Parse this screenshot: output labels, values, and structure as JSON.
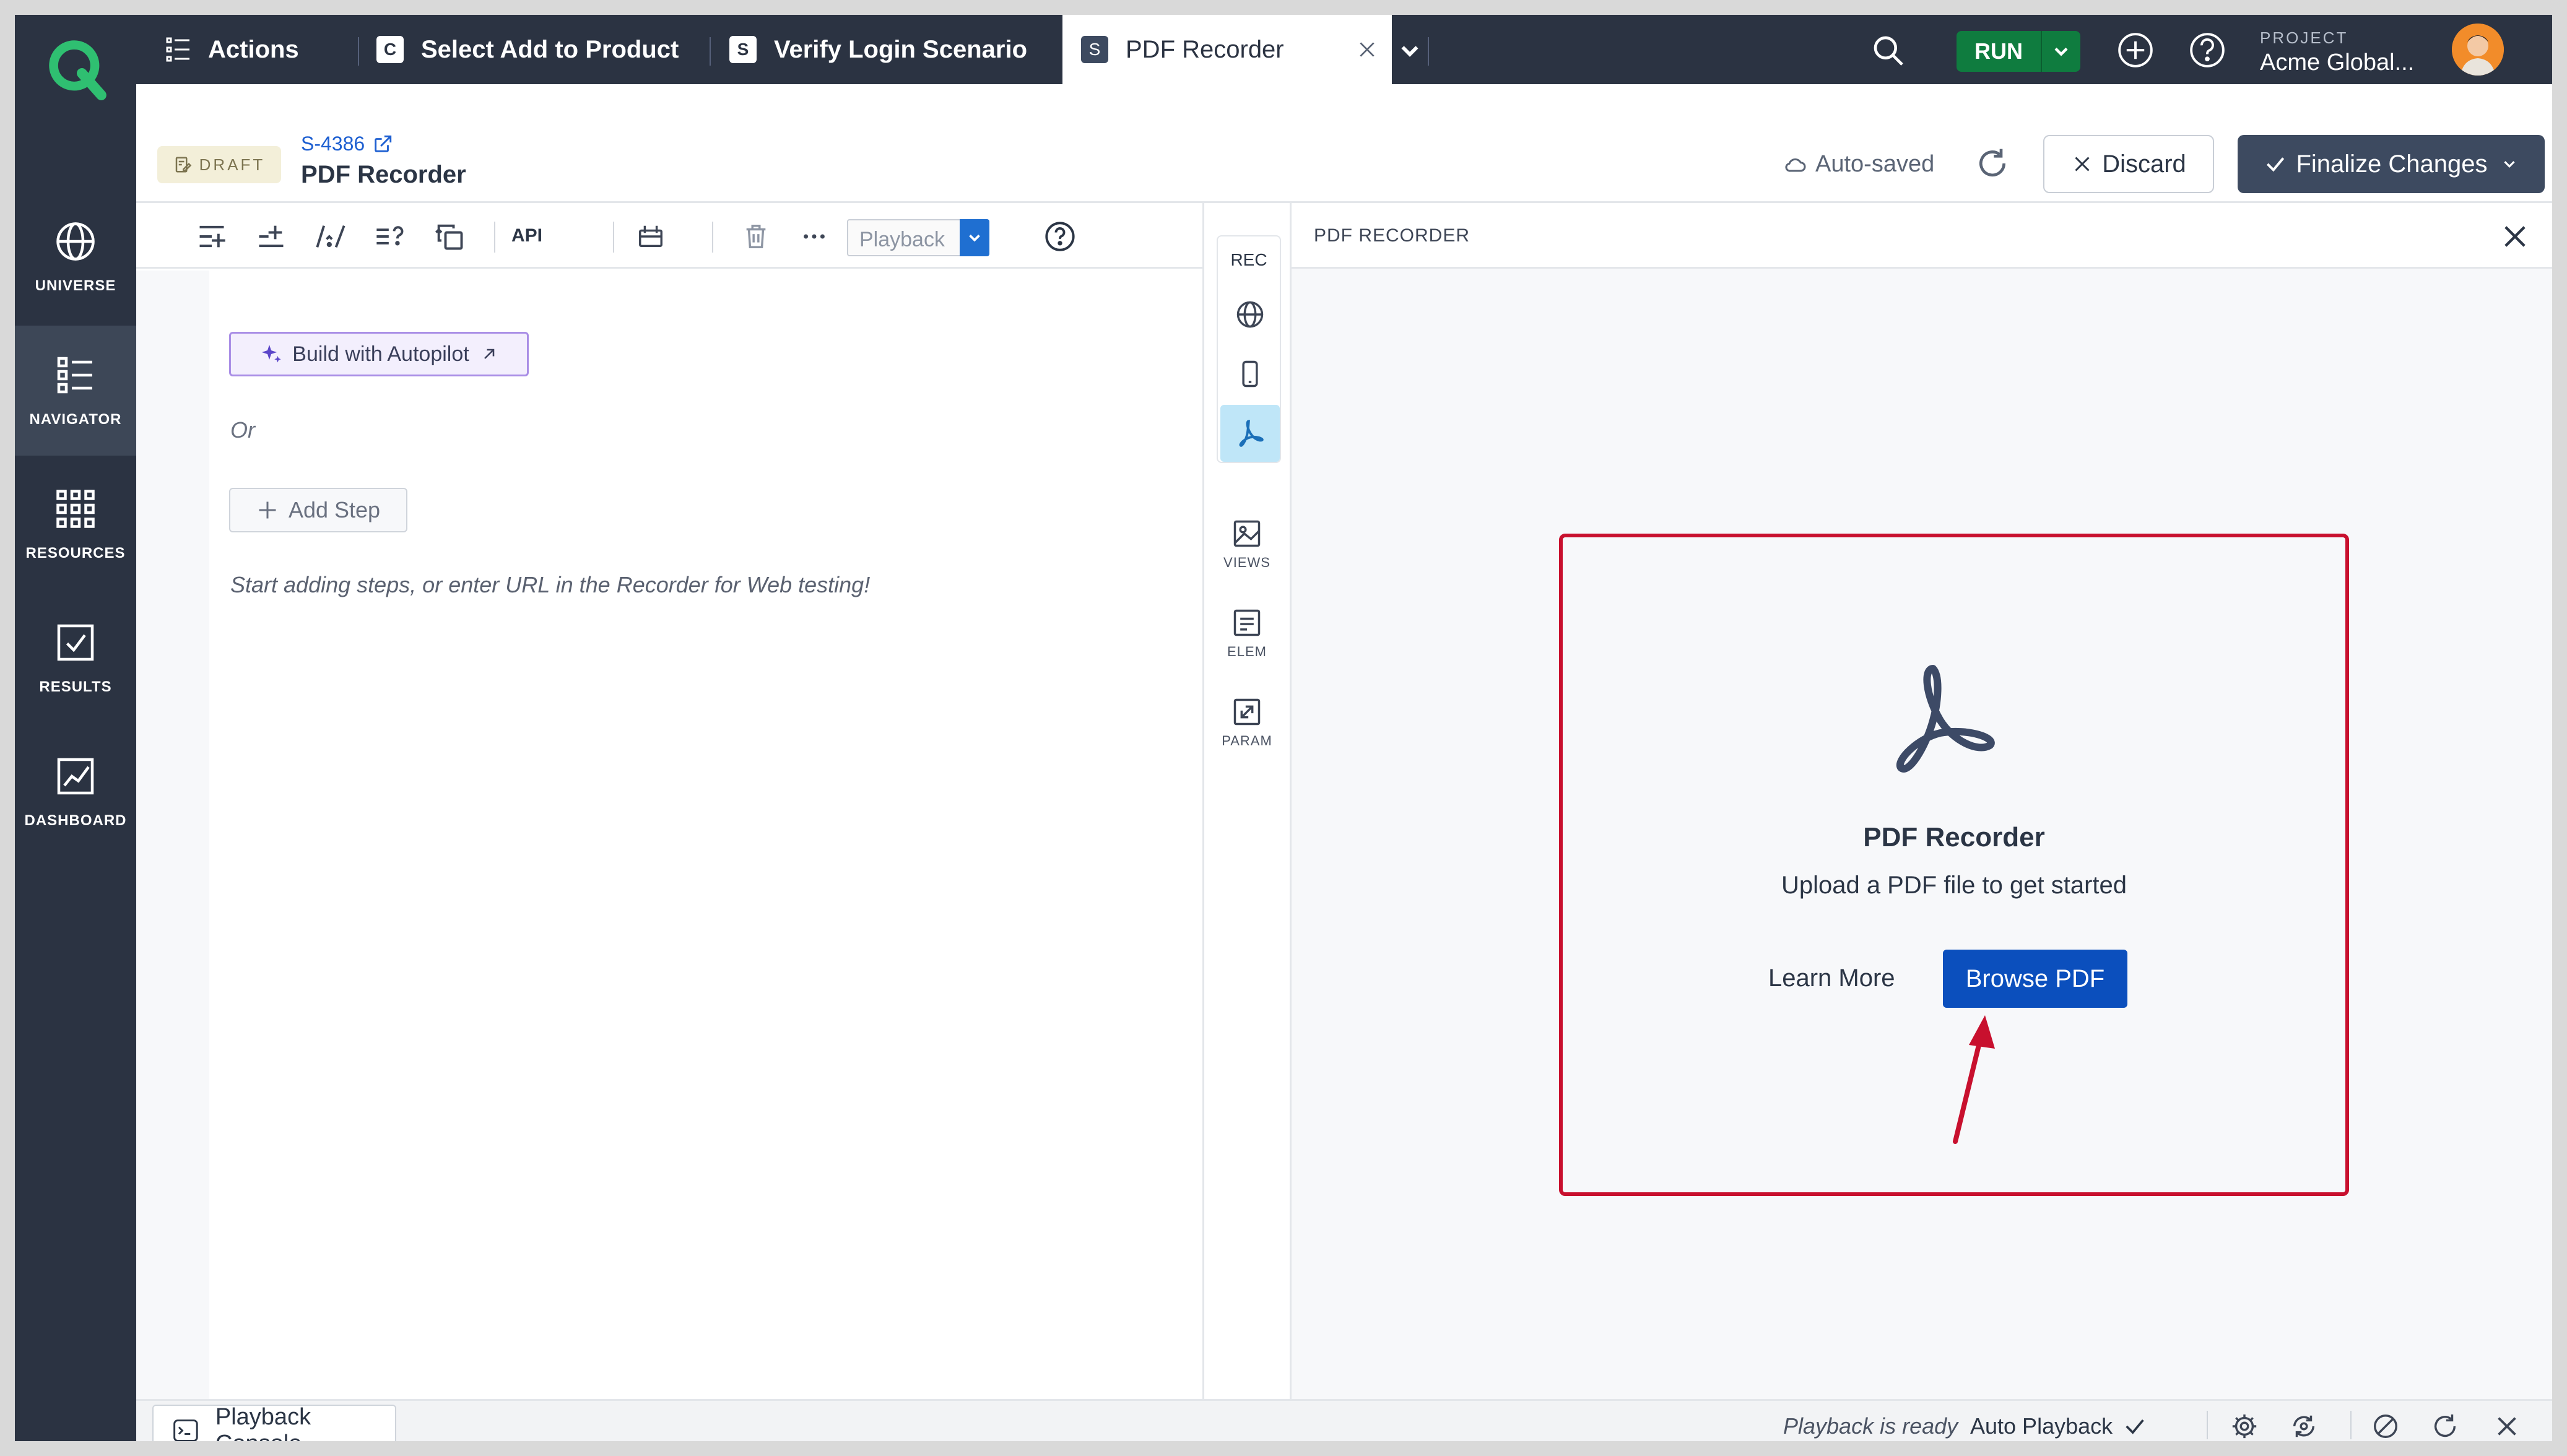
{
  "nav": {
    "items": [
      {
        "label": "UNIVERSE",
        "icon": "globe-icon"
      },
      {
        "label": "NAVIGATOR",
        "icon": "list-icon",
        "active": true
      },
      {
        "label": "RESOURCES",
        "icon": "grid-icon"
      },
      {
        "label": "RESULTS",
        "icon": "checkbox-icon"
      },
      {
        "label": "DASHBOARD",
        "icon": "chart-icon"
      }
    ]
  },
  "tabs": [
    {
      "label": "Actions",
      "badge": ""
    },
    {
      "label": "Select Add to Product",
      "badge": "C"
    },
    {
      "label": "Verify Login Scenario",
      "badge": "S"
    },
    {
      "label": "PDF Recorder",
      "badge": "S",
      "active": true
    }
  ],
  "topbar": {
    "run_label": "RUN",
    "project_label": "PROJECT",
    "project_name": "Acme Global..."
  },
  "header": {
    "draft_label": "DRAFT",
    "story_id": "S-4386",
    "title": "PDF Recorder",
    "autosaved": "Auto-saved",
    "discard_label": "Discard",
    "finalize_label": "Finalize Changes"
  },
  "toolbar": {
    "api_label": "API",
    "playback_placeholder": "Playback"
  },
  "editor": {
    "autopilot_label": "Build with Autopilot",
    "or_text": "Or",
    "add_step_label": "Add Step",
    "hint": "Start adding steps, or enter URL in the Recorder for Web testing!"
  },
  "rail": {
    "rec_label": "REC",
    "tools": [
      {
        "label": "VIEWS"
      },
      {
        "label": "ELEM"
      },
      {
        "label": "PARAM"
      }
    ]
  },
  "panel": {
    "title": "PDF RECORDER",
    "card_title": "PDF Recorder",
    "card_subtitle": "Upload a PDF file to get started",
    "learn_more": "Learn More",
    "browse_label": "Browse PDF",
    "highlight_color": "#c8102e"
  },
  "bottombar": {
    "console_label": "Playback Console",
    "status": "Playback is ready",
    "auto_playback": "Auto Playback"
  },
  "colors": {
    "nav_bg": "#2b3342",
    "run_green": "#0f7c3f",
    "primary_blue": "#0b4fbd",
    "finalize_bg": "#3d4a60"
  }
}
